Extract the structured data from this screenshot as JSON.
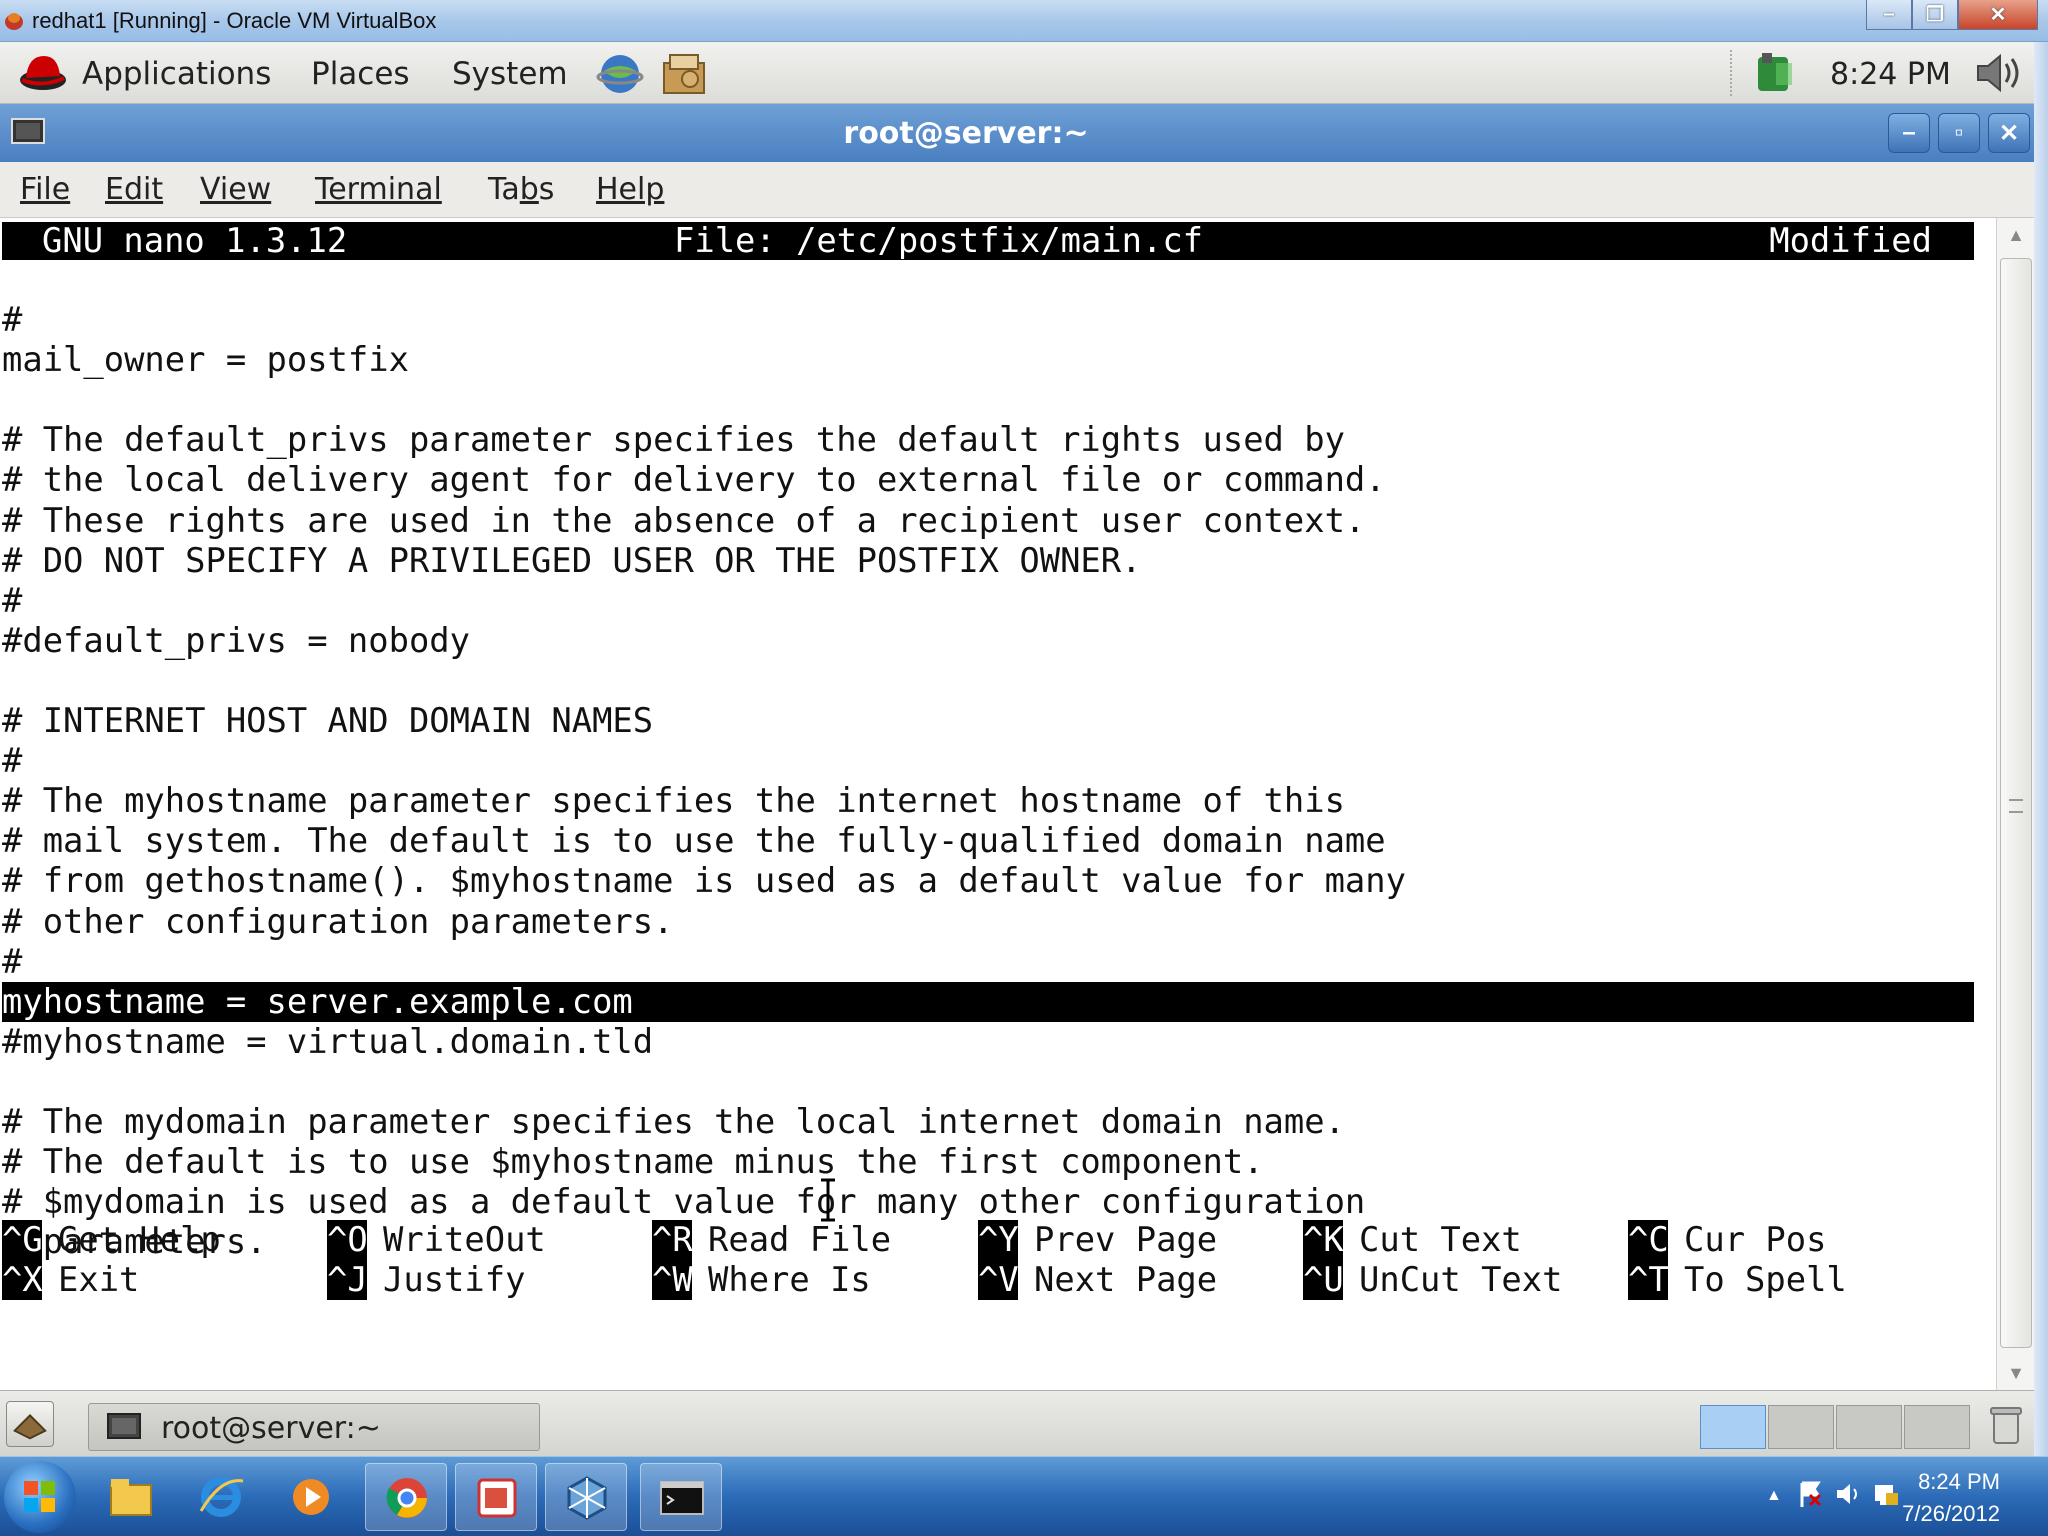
{
  "vbox": {
    "title": "redhat1 [Running] - Oracle VM VirtualBox",
    "buttons": [
      "minimize",
      "restore",
      "close"
    ]
  },
  "gnome_panel": {
    "menus": [
      "Applications",
      "Places",
      "System"
    ],
    "clock": "8:24 PM",
    "launchers": [
      "browser-launcher-icon",
      "file-manager-launcher-icon"
    ],
    "tray": [
      "network-icon",
      "volume-icon"
    ]
  },
  "terminal": {
    "title": "root@server:~",
    "menus": [
      {
        "label": "File",
        "underline": 0
      },
      {
        "label": "Edit",
        "underline": 0
      },
      {
        "label": "View",
        "underline": 0
      },
      {
        "label": "Terminal",
        "underline": 0
      },
      {
        "label": "Tabs",
        "underline": 2
      },
      {
        "label": "Help",
        "underline": 0
      }
    ]
  },
  "nano": {
    "version": "GNU nano 1.3.12",
    "file": "File: /etc/postfix/main.cf",
    "status": "Modified",
    "lines": [
      {
        "text": "#",
        "highlight": false
      },
      {
        "text": "mail_owner = postfix",
        "highlight": false
      },
      {
        "text": "",
        "highlight": false
      },
      {
        "text": "# The default_privs parameter specifies the default rights used by",
        "highlight": false
      },
      {
        "text": "# the local delivery agent for delivery to external file or command.",
        "highlight": false
      },
      {
        "text": "# These rights are used in the absence of a recipient user context.",
        "highlight": false
      },
      {
        "text": "# DO NOT SPECIFY A PRIVILEGED USER OR THE POSTFIX OWNER.",
        "highlight": false
      },
      {
        "text": "#",
        "highlight": false
      },
      {
        "text": "#default_privs = nobody",
        "highlight": false
      },
      {
        "text": "",
        "highlight": false
      },
      {
        "text": "# INTERNET HOST AND DOMAIN NAMES",
        "highlight": false
      },
      {
        "text": "#",
        "highlight": false
      },
      {
        "text": "# The myhostname parameter specifies the internet hostname of this",
        "highlight": false
      },
      {
        "text": "# mail system. The default is to use the fully-qualified domain name",
        "highlight": false
      },
      {
        "text": "# from gethostname(). $myhostname is used as a default value for many",
        "highlight": false
      },
      {
        "text": "# other configuration parameters.",
        "highlight": false
      },
      {
        "text": "#",
        "highlight": false
      },
      {
        "text": "myhostname = server.example.com",
        "highlight": true
      },
      {
        "text": "#myhostname = virtual.domain.tld",
        "highlight": false
      },
      {
        "text": "",
        "highlight": false
      },
      {
        "text": "# The mydomain parameter specifies the local internet domain name.",
        "highlight": false
      },
      {
        "text": "# The default is to use $myhostname minus the first component.",
        "highlight": false
      },
      {
        "text": "# $mydomain is used as a default value for many other configuration",
        "highlight": false
      },
      {
        "text": "# parameters.",
        "highlight": false
      }
    ],
    "shortcuts_row1": [
      {
        "key": "^G",
        "label": "Get Help"
      },
      {
        "key": "^O",
        "label": "WriteOut"
      },
      {
        "key": "^R",
        "label": "Read File"
      },
      {
        "key": "^Y",
        "label": "Prev Page"
      },
      {
        "key": "^K",
        "label": "Cut Text"
      },
      {
        "key": "^C",
        "label": "Cur Pos"
      }
    ],
    "shortcuts_row2": [
      {
        "key": "^X",
        "label": "Exit"
      },
      {
        "key": "^J",
        "label": "Justify"
      },
      {
        "key": "^W",
        "label": "Where Is"
      },
      {
        "key": "^V",
        "label": "Next Page"
      },
      {
        "key": "^U",
        "label": "UnCut Text"
      },
      {
        "key": "^T",
        "label": "To Spell"
      }
    ]
  },
  "gnome_bottom": {
    "task_label": "root@server:~",
    "workspaces": 4,
    "active_workspace": 1
  },
  "win_taskbar": {
    "apps": [
      "explorer-icon",
      "internet-explorer-icon",
      "media-player-icon",
      "chrome-icon",
      "office-icon",
      "virtualbox-icon",
      "cmd-icon"
    ],
    "time": "8:24 PM",
    "date": "7/26/2012"
  },
  "colors": {
    "vbox_title": "#a9c8ea",
    "gnome_title_blue": "#4a7fc0",
    "terminal_bg": "#ffffff",
    "nano_inverse": "#000000",
    "win_taskbar": "#2c6bb8"
  }
}
